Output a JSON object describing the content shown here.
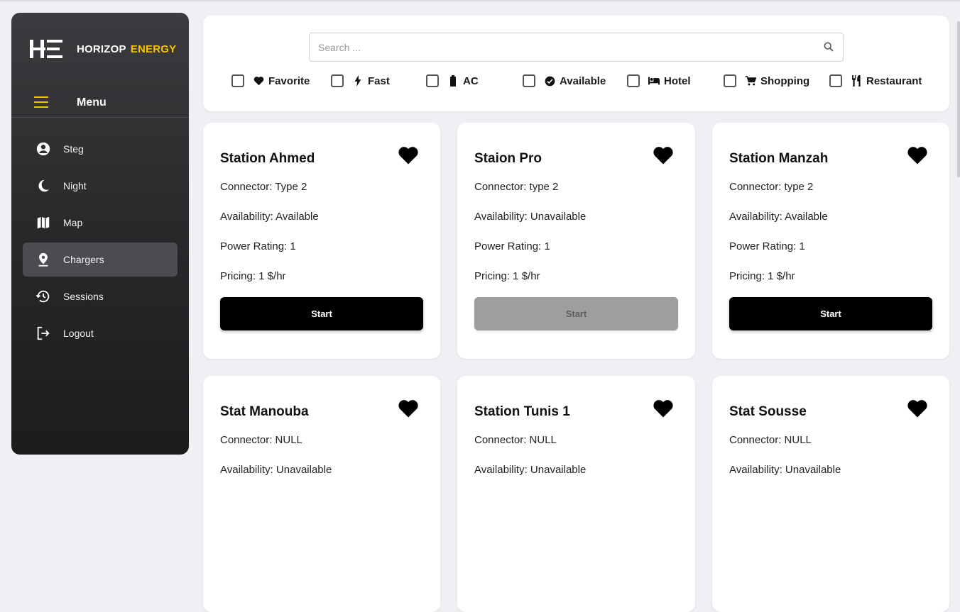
{
  "brand": {
    "name": "HORIZOP",
    "accent": "ENERGY",
    "accent_color": "#f5c400"
  },
  "menu": {
    "label": "Menu"
  },
  "nav": [
    {
      "label": "Steg",
      "icon": "account-circle-icon"
    },
    {
      "label": "Night",
      "icon": "moon-icon"
    },
    {
      "label": "Map",
      "icon": "map-icon"
    },
    {
      "label": "Chargers",
      "icon": "location-pin-icon",
      "active": true
    },
    {
      "label": "Sessions",
      "icon": "history-icon"
    },
    {
      "label": "Logout",
      "icon": "logout-icon"
    }
  ],
  "search": {
    "placeholder": "Search ...",
    "value": ""
  },
  "filters": [
    {
      "label": "Favorite",
      "icon": "heart-icon",
      "checked": false
    },
    {
      "label": "Fast",
      "icon": "bolt-icon",
      "checked": false
    },
    {
      "label": "AC",
      "icon": "battery-icon",
      "checked": false
    },
    {
      "label": "Available",
      "icon": "check-circle-icon",
      "checked": false
    },
    {
      "label": "Hotel",
      "icon": "bed-icon",
      "checked": false
    },
    {
      "label": "Shopping",
      "icon": "cart-icon",
      "checked": false
    },
    {
      "label": "Restaurant",
      "icon": "utensils-icon",
      "checked": false
    }
  ],
  "stations": [
    {
      "name": "Station Ahmed",
      "connector": "Connector: Type 2",
      "availability": "Availability: Available",
      "power": "Power Rating: 1",
      "pricing": "Pricing: 1 $/hr",
      "button": "Start",
      "enabled": true
    },
    {
      "name": "Staion Pro",
      "connector": "Connector: type 2",
      "availability": "Availability: Unavailable",
      "power": "Power Rating: 1",
      "pricing": "Pricing: 1 $/hr",
      "button": "Start",
      "enabled": false
    },
    {
      "name": "Station Manzah",
      "connector": "Connector: type 2",
      "availability": "Availability: Available",
      "power": "Power Rating: 1",
      "pricing": "Pricing: 1 $/hr",
      "button": "Start",
      "enabled": true
    },
    {
      "name": "Stat Manouba",
      "connector": "Connector: NULL",
      "availability": "Availability: Unavailable"
    },
    {
      "name": "Station Tunis 1",
      "connector": "Connector: NULL",
      "availability": "Availability: Unavailable"
    },
    {
      "name": "Stat Sousse",
      "connector": "Connector: NULL",
      "availability": "Availability: Unavailable"
    }
  ]
}
